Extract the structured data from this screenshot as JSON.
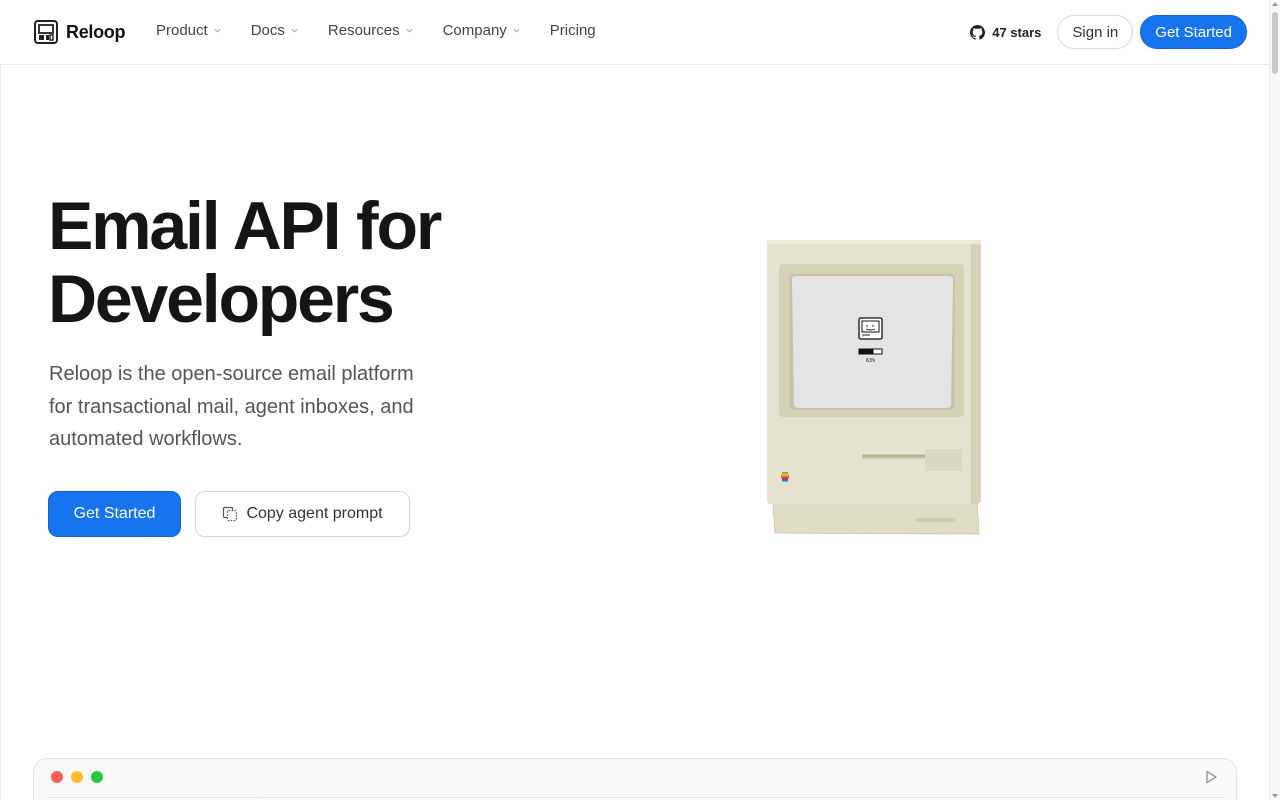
{
  "brand": {
    "name": "Reloop",
    "icon": "reloop-logo-icon"
  },
  "nav": {
    "items": [
      {
        "label": "Product",
        "has_dropdown": true
      },
      {
        "label": "Docs",
        "has_dropdown": true
      },
      {
        "label": "Resources",
        "has_dropdown": true
      },
      {
        "label": "Company",
        "has_dropdown": true
      },
      {
        "label": "Pricing",
        "has_dropdown": false
      }
    ],
    "github_stars": "47 stars",
    "sign_in": "Sign in",
    "get_started": "Get Started"
  },
  "hero": {
    "title_line1": "Email API for",
    "title_line2": "Developers",
    "subtitle": "Reloop is the open-source email platform for transactional mail, agent inboxes, and automated workflows.",
    "cta_primary": "Get Started",
    "cta_secondary": "Copy agent prompt",
    "cta_secondary_icon": "copy-icon"
  },
  "illustration": {
    "screen_text": "63%",
    "loading_progress": 0.63
  },
  "colors": {
    "accent": "#1574ee",
    "mac_beige": "#e7e2cf",
    "window_close": "#ff5f57",
    "window_minimize": "#febc2e",
    "window_maximize": "#28c840"
  }
}
